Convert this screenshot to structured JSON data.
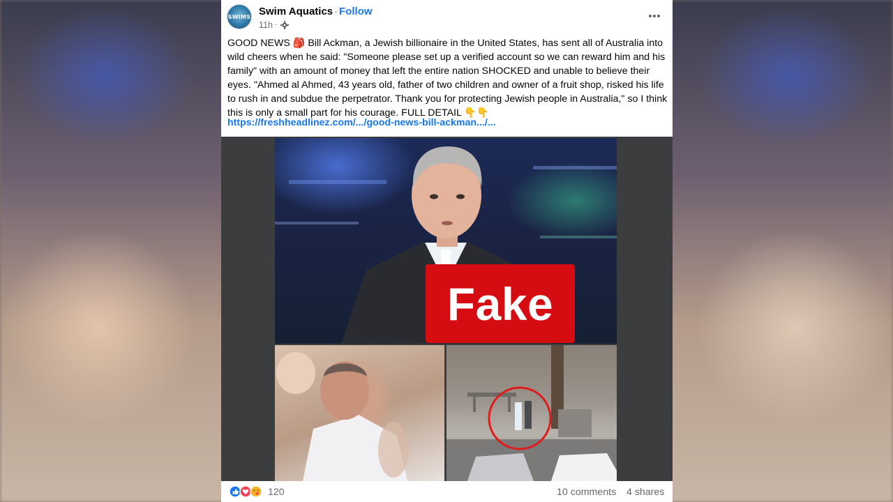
{
  "post": {
    "page_name": "Swim Aquatics",
    "follow_label": "Follow",
    "avatar_text": "SWIMS",
    "time": "11h",
    "text": "GOOD NEWS 🎒 Bill Ackman, a Jewish billionaire in the United States, has sent all of Australia into wild cheers when he said: \"Someone please set up a verified account so we can reward him and his family\" with an amount of money that left the entire nation SHOCKED and unable to believe their eyes. \"Ahmed al Ahmed, 43 years old, father of two children and owner of a fruit shop, risked his life to rush in and subdue the perpetrator. Thank you for protecting Jewish people in Australia,\" so I think this is only a small part for his courage. FULL DETAIL 👇👇",
    "link": "https://freshheadlinez.com/.../good-news-bill-ackman.../...",
    "audience_icon": "gear-icon",
    "more_icon": "more-options-icon"
  },
  "media": {
    "badge_text": "Fake",
    "badge_color": "#d50d12",
    "highlight_color": "#e01b1b"
  },
  "footer": {
    "reaction_icons": [
      "like-icon",
      "love-icon",
      "care-icon"
    ],
    "reaction_count": "120",
    "comments": "10 comments",
    "shares": "4 shares"
  }
}
